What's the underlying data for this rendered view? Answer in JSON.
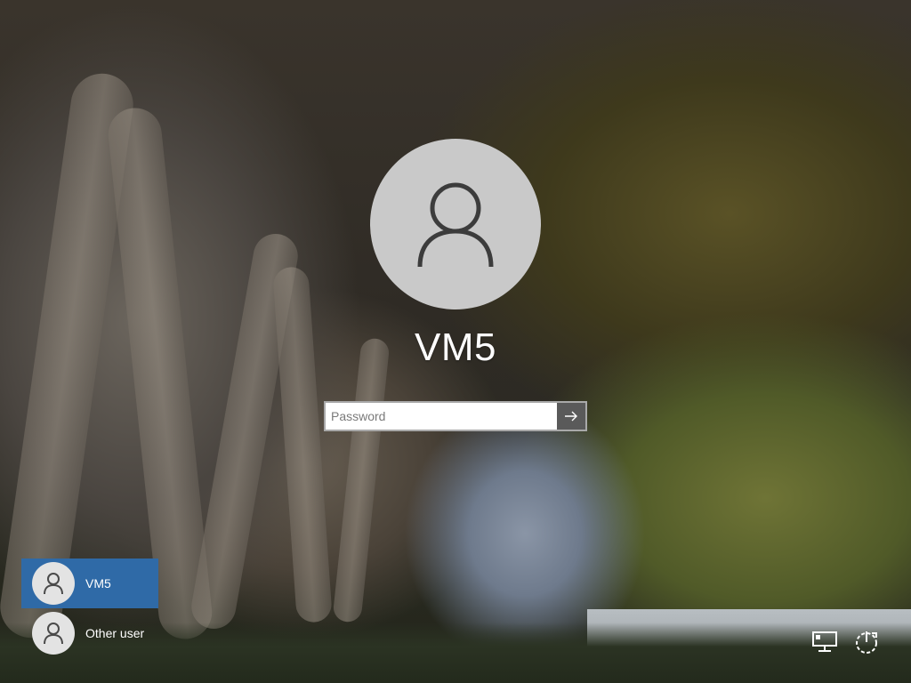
{
  "login": {
    "username": "VM5",
    "password_placeholder": "Password",
    "password_value": ""
  },
  "user_list": [
    {
      "label": "VM5",
      "selected": true,
      "icon": "user-icon"
    },
    {
      "label": "Other user",
      "selected": false,
      "icon": "user-icon"
    }
  ],
  "system_icons": [
    {
      "name": "network-icon"
    },
    {
      "name": "power-icon"
    }
  ],
  "colors": {
    "selected_tile": "#2f6aa7",
    "avatar_bg": "#c9c9c9",
    "submit_button": "#5a5a5a"
  }
}
